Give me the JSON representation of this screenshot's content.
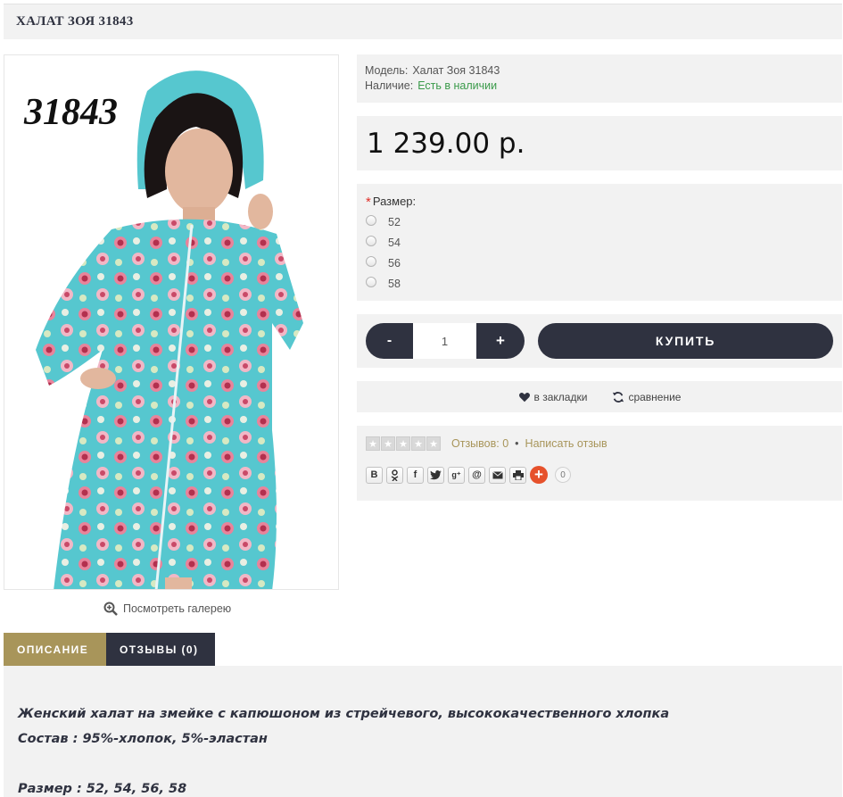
{
  "product": {
    "title": "ХАЛАТ ЗОЯ 31843",
    "photo_code": "31843",
    "gallery_label": "Посмотреть галерею"
  },
  "info": {
    "model_label": "Модель:",
    "model_value": "Халат Зоя 31843",
    "availability_label": "Наличие:",
    "availability_value": "Есть в наличии"
  },
  "price": "1 239.00 р.",
  "size": {
    "required_mark": "*",
    "label": "Размер:",
    "options": [
      "52",
      "54",
      "56",
      "58"
    ]
  },
  "buy": {
    "minus": "-",
    "quantity": "1",
    "plus": "+",
    "buy_label": "КУПИТЬ"
  },
  "actions": {
    "wishlist": "в закладки",
    "compare": "сравнение"
  },
  "reviews": {
    "rating_stars": 0,
    "reviews_link": "Отзывов: 0",
    "separator": "•",
    "write_link": "Написать отзыв"
  },
  "share": {
    "buttons": [
      "B",
      "ok",
      "f",
      "tw",
      "g+",
      "@",
      "mail",
      "print"
    ],
    "count": "0"
  },
  "tabs": [
    {
      "label": "ОПИСАНИЕ",
      "active": true
    },
    {
      "label": "ОТЗЫВЫ (0)",
      "active": false
    }
  ],
  "description": {
    "line1": "Женский халат на змейке с капюшоном из стрейчевого, высококачественного хлопка",
    "line2": "Состав : 95%-хлопок, 5%-эластан",
    "line3": "Размер : 52, 54, 56, 58"
  },
  "colors": {
    "dark": "#2f3240",
    "accent": "#a8955a",
    "stock_green": "#3a9a4a",
    "panel_bg": "#f2f2f2",
    "share_plus": "#e6512b"
  }
}
